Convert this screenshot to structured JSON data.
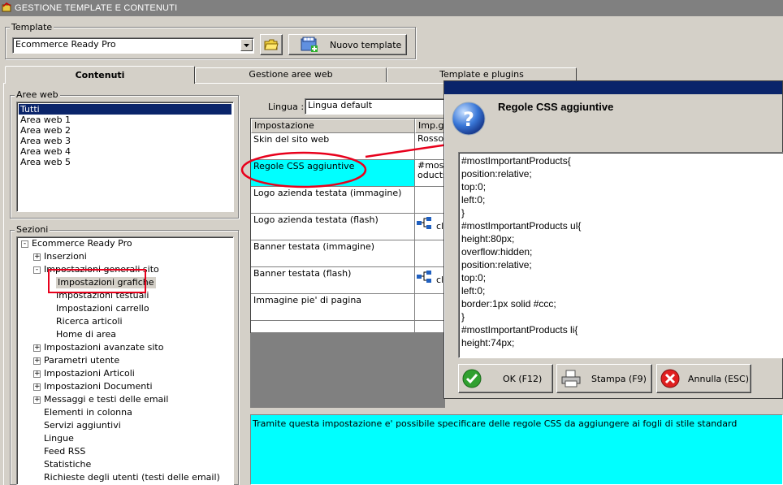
{
  "window": {
    "title": "GESTIONE TEMPLATE E CONTENUTI"
  },
  "template_group": {
    "label": "Template",
    "selected": "Ecommerce Ready Pro",
    "new_button": "Nuovo template"
  },
  "tabs": [
    {
      "label": "Contenuti",
      "active": true
    },
    {
      "label": "Gestione aree web",
      "active": false
    },
    {
      "label": "Template e plugins",
      "active": false
    }
  ],
  "aree_web": {
    "label": "Aree web",
    "items": [
      "Tutti",
      "Area web 1",
      "Area web 2",
      "Area web 3",
      "Area web 4",
      "Area web 5"
    ],
    "selected_index": 0
  },
  "sezioni": {
    "label": "Sezioni",
    "tree": [
      {
        "label": "Ecommerce Ready Pro",
        "expand": "-"
      },
      {
        "label": "Inserzioni",
        "expand": "+"
      },
      {
        "label": "Impostazioni generali sito",
        "expand": "-"
      },
      {
        "label": "Impostazioni grafiche",
        "expand": ""
      },
      {
        "label": "Impostazioni testuali",
        "expand": ""
      },
      {
        "label": "Impostazioni carrello",
        "expand": ""
      },
      {
        "label": "Ricerca articoli",
        "expand": ""
      },
      {
        "label": "Home di area",
        "expand": ""
      },
      {
        "label": "Impostazioni avanzate sito",
        "expand": "+"
      },
      {
        "label": "Parametri utente",
        "expand": "+"
      },
      {
        "label": "Impostazioni Articoli",
        "expand": "+"
      },
      {
        "label": "Impostazioni Documenti",
        "expand": "+"
      },
      {
        "label": "Messaggi e testi delle email",
        "expand": "+"
      },
      {
        "label": "Elementi in colonna",
        "expand": ""
      },
      {
        "label": "Servizi aggiuntivi",
        "expand": ""
      },
      {
        "label": "Lingue",
        "expand": ""
      },
      {
        "label": "Feed RSS",
        "expand": ""
      },
      {
        "label": "Statistiche",
        "expand": ""
      },
      {
        "label": "Richieste degli utenti (testi delle email)",
        "expand": ""
      }
    ]
  },
  "lingua": {
    "label": "Lingua :",
    "value": "Lingua default"
  },
  "settings_grid": {
    "headers": [
      "Impostazione",
      "Imp.ge"
    ],
    "rows": [
      {
        "name": "Skin del sito web",
        "value": "Rosso"
      },
      {
        "name": "Regole CSS aggiuntive",
        "value": "#mostl",
        "value2": "oducts"
      },
      {
        "name": "Logo azienda testata (immagine)",
        "value": ""
      },
      {
        "name": "Logo azienda testata (flash)",
        "value": "cl"
      },
      {
        "name": "Banner testata (immagine)",
        "value": ""
      },
      {
        "name": "Banner testata (flash)",
        "value": "cl"
      },
      {
        "name": "Immagine pie' di pagina",
        "value": ""
      }
    ]
  },
  "description": "Tramite questa impostazione e' possibile specificare delle regole CSS da aggiungere ai fogli di stile standard",
  "dialog": {
    "title": "Regole CSS aggiuntive",
    "code_lines": [
      "#mostImportantProducts{",
      "position:relative;",
      "top:0;",
      "left:0;",
      "}",
      "#mostImportantProducts ul{",
      "height:80px;",
      "overflow:hidden;",
      "position:relative;",
      "top:0;",
      "left:0;",
      "border:1px solid #ccc;",
      "}",
      "#mostImportantProducts li{",
      "height:74px;"
    ],
    "ok_button": "OK (F12)",
    "print_button": "Stampa (F9)",
    "cancel_button": "Annulla (ESC)"
  },
  "colors": {
    "selection": "#0a246a",
    "highlight_cyan": "#00ffff",
    "annotation_red": "#e8001c"
  }
}
